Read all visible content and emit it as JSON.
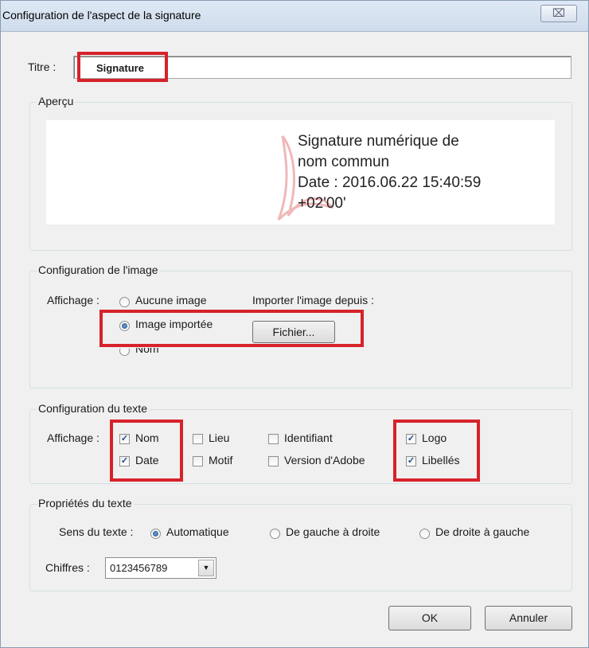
{
  "window": {
    "title": "Configuration de l'aspect de la signature",
    "close_glyph": "⌧"
  },
  "titre": {
    "label": "Titre :",
    "value": "Signature"
  },
  "apercu": {
    "legend": "Aperçu",
    "preview_lines": [
      "Signature numérique de",
      "nom commun",
      "Date : 2016.06.22 15:40:59",
      "+02'00'"
    ]
  },
  "image_config": {
    "legend": "Configuration de l'image",
    "affichage_label": "Affichage :",
    "options": [
      {
        "label": "Aucune image",
        "selected": false
      },
      {
        "label": "Image importée",
        "selected": true
      },
      {
        "label": "Nom",
        "selected": false
      }
    ],
    "import_label": "Importer l'image depuis :",
    "file_button": "Fichier..."
  },
  "text_config": {
    "legend": "Configuration du texte",
    "affichage_label": "Affichage :",
    "checks": [
      {
        "label": "Nom",
        "checked": true
      },
      {
        "label": "Date",
        "checked": true
      },
      {
        "label": "Lieu",
        "checked": false
      },
      {
        "label": "Motif",
        "checked": false
      },
      {
        "label": "Identifiant",
        "checked": false
      },
      {
        "label": "Version d'Adobe",
        "checked": false
      },
      {
        "label": "Logo",
        "checked": true
      },
      {
        "label": "Libellés",
        "checked": true
      }
    ]
  },
  "text_props": {
    "legend": "Propriétés du texte",
    "direction_label": "Sens du texte :",
    "directions": [
      {
        "label": "Automatique",
        "selected": true
      },
      {
        "label": "De gauche à droite",
        "selected": false
      },
      {
        "label": "De droite à gauche",
        "selected": false
      }
    ],
    "chiffres_label": "Chiffres :",
    "chiffres_value": "0123456789"
  },
  "buttons": {
    "ok": "OK",
    "cancel": "Annuler"
  },
  "colors": {
    "highlight_red": "#d7222a",
    "checkmark": "#1f4a8a"
  }
}
